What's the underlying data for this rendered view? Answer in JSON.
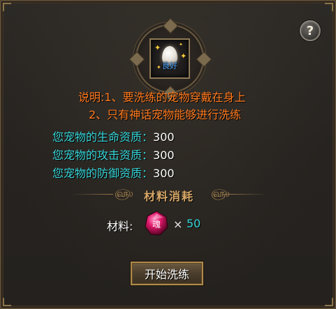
{
  "help_button": {
    "label": "?"
  },
  "pet_slot": {
    "label": "良好"
  },
  "description": {
    "line1": "说明:1、要洗练的宠物穿戴在身上",
    "line2": "2、只有神话宠物能够进行洗练"
  },
  "stats": [
    {
      "label": "您宠物的生命资质：",
      "value": "300"
    },
    {
      "label": "您宠物的攻击资质：",
      "value": "300"
    },
    {
      "label": "您宠物的防御资质：",
      "value": "300"
    }
  ],
  "materials_section": {
    "title": "材料消耗"
  },
  "material": {
    "label": "材料:",
    "icon_text": "魂",
    "times": "×",
    "quantity": "50"
  },
  "start_button": {
    "label": "开始洗练"
  },
  "colors": {
    "description": "#ff7a1e",
    "stat_label": "#36d6d9",
    "quantity": "#36d6d9",
    "section_title": "#d8a868",
    "slot_label": "#4aa4ff"
  }
}
